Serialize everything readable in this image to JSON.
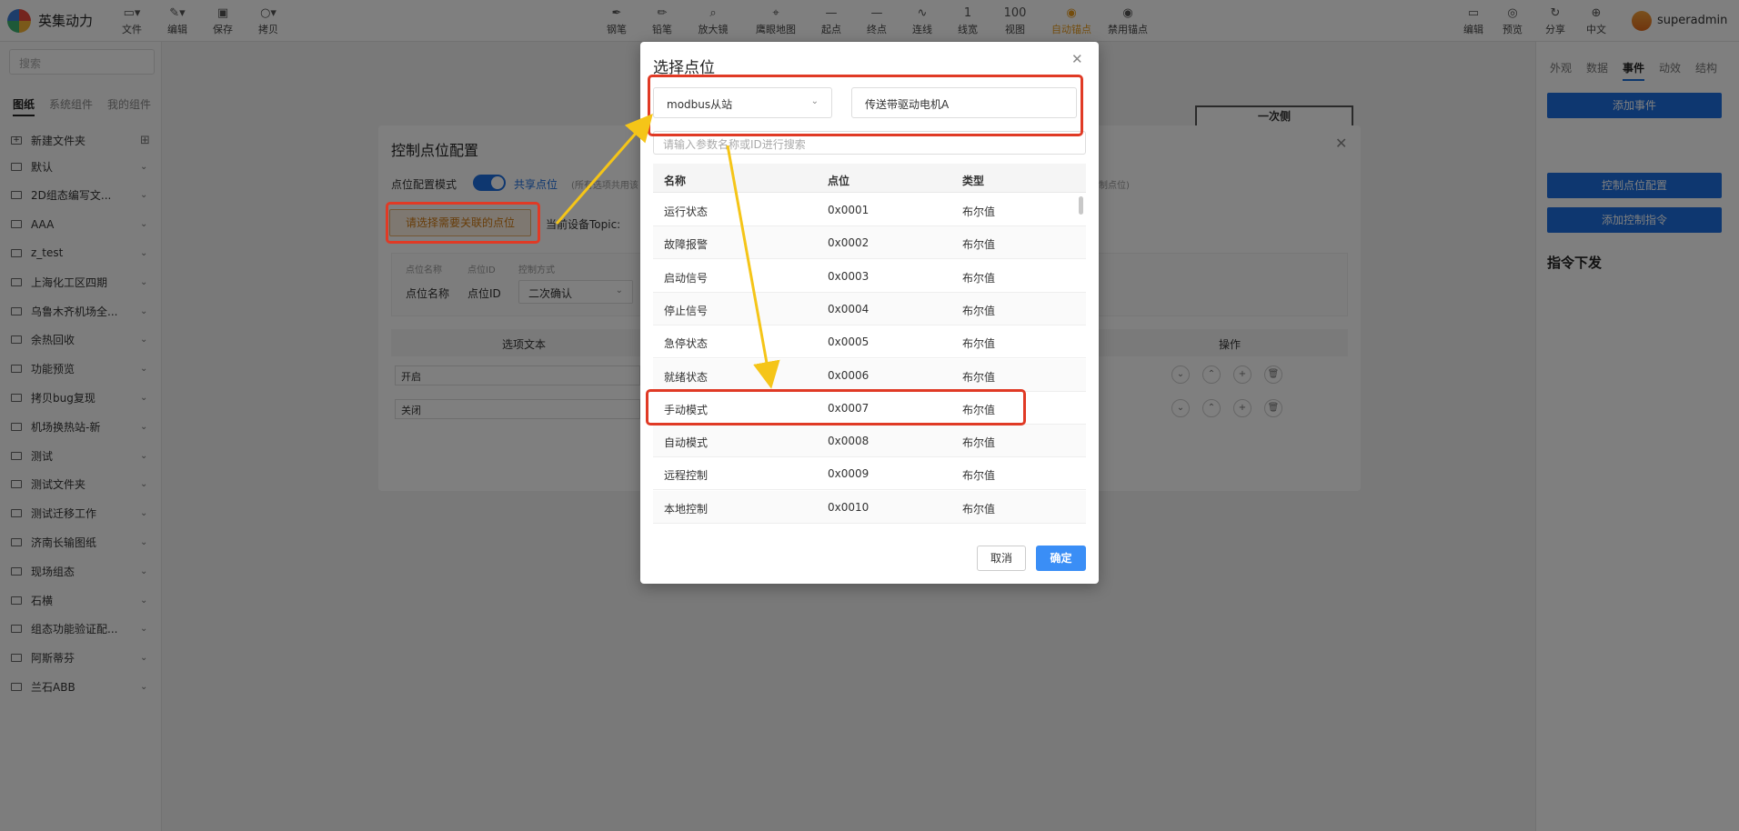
{
  "app": {
    "name": "英集动力",
    "user": "superadmin"
  },
  "toolbar": {
    "left": [
      "文件",
      "编辑",
      "保存",
      "拷贝"
    ],
    "center": [
      "钢笔",
      "铅笔",
      "放大镜",
      "鹰眼地图",
      "起点",
      "终点",
      "连线",
      "线宽",
      "视图",
      "自动锚点",
      "禁用锚点"
    ],
    "line_width_value": "1",
    "zoom_value": "100",
    "right": [
      "编辑",
      "预览",
      "分享",
      "中文"
    ]
  },
  "left_panel": {
    "search_placeholder": "搜索",
    "tabs": [
      "图纸",
      "系统组件",
      "我的组件"
    ],
    "new_folder": "新建文件夹",
    "folders": [
      "默认",
      "2D组态编写文...",
      "AAA",
      "z_test",
      "上海化工区四期",
      "乌鲁木齐机场全...",
      "余热回收",
      "功能预览",
      "拷贝bug复现",
      "机场换热站-新",
      "测试",
      "测试文件夹",
      "测试迁移工作",
      "济南长输图纸",
      "现场组态",
      "石横",
      "组态功能验证配...",
      "阿斯蒂芬",
      "兰石ABB"
    ]
  },
  "right_panel": {
    "tabs": [
      "外观",
      "数据",
      "事件",
      "动效",
      "结构"
    ],
    "add_event": "添加事件",
    "control_point_config": "控制点位配置",
    "add_control_command": "添加控制指令",
    "heading": "指令下发"
  },
  "canvas": {
    "box_label": "一次侧"
  },
  "back_modal": {
    "title": "控制点位配置",
    "mode_label": "点位配置模式",
    "mode_value": "共享点位",
    "mode_hint_left": "(所有选项共用该",
    "mode_hint_right": "制点位)",
    "select_button": "请选择需要关联的点位",
    "topic_label": "当前设备Topic:",
    "info_headers": [
      "点位名称",
      "点位ID",
      "控制方式"
    ],
    "info_values": [
      "点位名称",
      "点位ID"
    ],
    "control_method": "二次确认",
    "table_headers": [
      "选项文本",
      "操作"
    ],
    "options": [
      "开启",
      "关闭"
    ]
  },
  "dialog": {
    "title": "选择点位",
    "source_select": "modbus从站",
    "device_input": "传送带驱动电机A",
    "search_placeholder": "请输入参数名称或ID进行搜索",
    "columns": [
      "名称",
      "点位",
      "类型"
    ],
    "rows": [
      {
        "name": "运行状态",
        "addr": "0x0001",
        "type": "布尔值"
      },
      {
        "name": "故障报警",
        "addr": "0x0002",
        "type": "布尔值"
      },
      {
        "name": "启动信号",
        "addr": "0x0003",
        "type": "布尔值"
      },
      {
        "name": "停止信号",
        "addr": "0x0004",
        "type": "布尔值"
      },
      {
        "name": "急停状态",
        "addr": "0x0005",
        "type": "布尔值"
      },
      {
        "name": "就绪状态",
        "addr": "0x0006",
        "type": "布尔值"
      },
      {
        "name": "手动模式",
        "addr": "0x0007",
        "type": "布尔值"
      },
      {
        "name": "自动模式",
        "addr": "0x0008",
        "type": "布尔值"
      },
      {
        "name": "远程控制",
        "addr": "0x0009",
        "type": "布尔值"
      },
      {
        "name": "本地控制",
        "addr": "0x0010",
        "type": "布尔值"
      }
    ],
    "cancel": "取消",
    "ok": "确定"
  },
  "colors": {
    "accent": "#1d6fe0",
    "highlight": "#e03a25",
    "arrow": "#f5c518",
    "orange": "#e89a1c"
  }
}
